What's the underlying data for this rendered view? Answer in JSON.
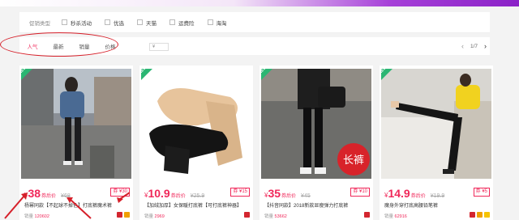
{
  "filters": {
    "label": "促销类型",
    "options": [
      "秒杀活动",
      "优选",
      "天猫",
      "运费险",
      "海淘"
    ]
  },
  "sort": {
    "tabs": [
      "人气",
      "最新",
      "销量",
      "价格"
    ],
    "active_index": 0,
    "price_placeholder": "¥",
    "pager": "1/7"
  },
  "colors": {
    "accent": "#f0285a",
    "annotation": "#d6202a",
    "new_badge": "#2bb673"
  },
  "products": [
    {
      "badge": "NEW",
      "price": "38",
      "price_suffix": "券后价",
      "original": "¥68",
      "coupon": "券 ¥30",
      "title": "杨幂同款【不起球不掉色】打底裤魔术裤",
      "sales_label": "销量",
      "sales": "120602"
    },
    {
      "badge": "NEW",
      "price": "10.9",
      "price_suffix": "券后价",
      "original": "¥25.9",
      "coupon": "券 ¥15",
      "title": "【加绒加厚】女保暖打底裤【可打底裤神器】",
      "sales_label": "销量",
      "sales": "2969"
    },
    {
      "badge": "NEW",
      "price": "35",
      "price_suffix": "券后价",
      "original": "¥45",
      "coupon": "券 ¥10",
      "title": "【抖音同款】2018新款显瘦弹力打底裤",
      "sales_label": "销量",
      "sales": "53662",
      "overlay": "长裤"
    },
    {
      "badge": "NEW",
      "price": "14.9",
      "price_suffix": "券后价",
      "original": "¥19.9",
      "coupon": "券 ¥5",
      "title": "魔身外穿打底高腰铅笔裤",
      "sales_label": "销量",
      "sales": "62916"
    }
  ]
}
